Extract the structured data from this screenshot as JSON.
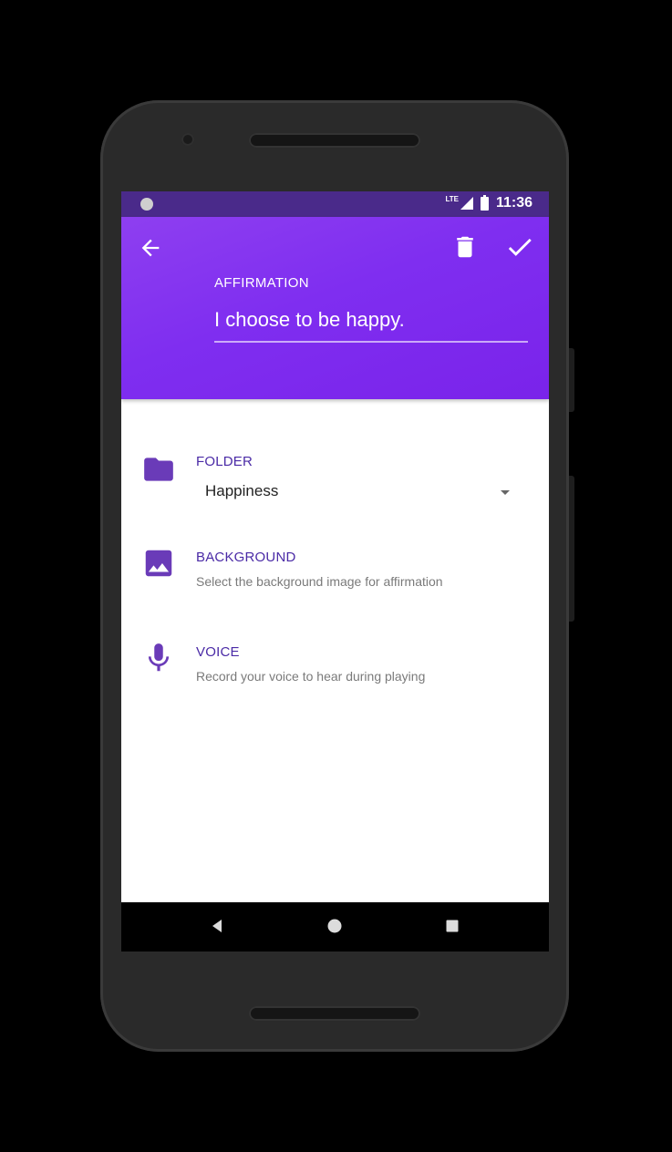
{
  "status_bar": {
    "network": "LTE",
    "time": "11:36"
  },
  "header": {
    "label": "AFFIRMATION",
    "affirmation_value": "I choose to be happy.",
    "icons": {
      "back": "arrow-left-icon",
      "delete": "trash-icon",
      "save": "check-icon"
    }
  },
  "settings": {
    "folder": {
      "title": "FOLDER",
      "selected": "Happiness",
      "icon": "folder-icon"
    },
    "background": {
      "title": "BACKGROUND",
      "subtitle": "Select the background image for affirmation",
      "icon": "image-icon"
    },
    "voice": {
      "title": "VOICE",
      "subtitle": "Record your voice to hear during playing",
      "icon": "microphone-icon"
    }
  },
  "nav_bar": {
    "icons": [
      "back-triangle-icon",
      "home-circle-icon",
      "recents-square-icon"
    ]
  },
  "colors": {
    "header_purple": "#7f2ef0",
    "status_bar": "#4a2a8a",
    "accent_icon": "#6a3bb8",
    "accent_text": "#4a2aa6"
  }
}
